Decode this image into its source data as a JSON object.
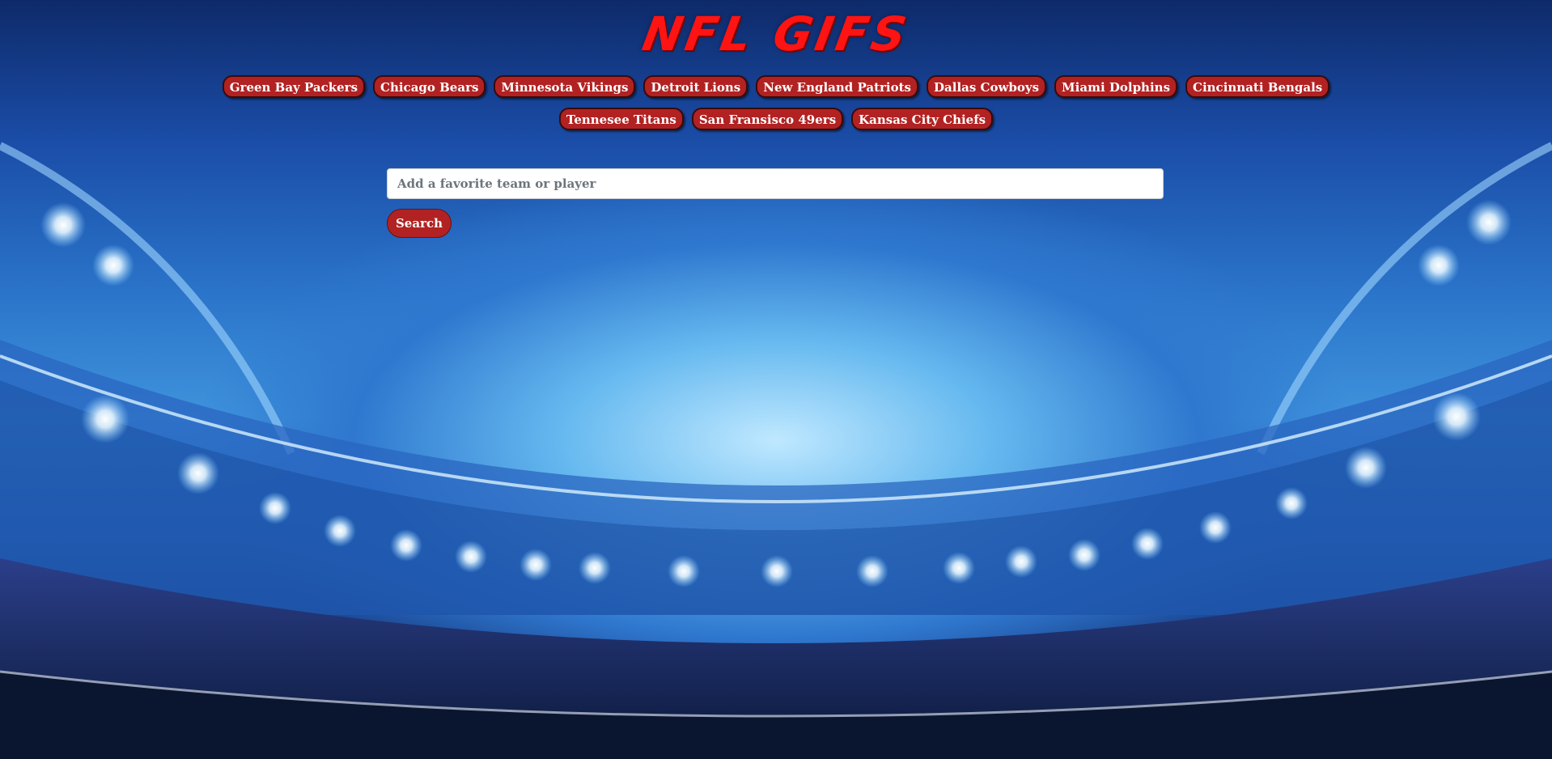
{
  "header": {
    "title": "NFL GIFS"
  },
  "teams": [
    "Green Bay Packers",
    "Chicago Bears",
    "Minnesota Vikings",
    "Detroit Lions",
    "New England Patriots",
    "Dallas Cowboys",
    "Miami Dolphins",
    "Cincinnati Bengals",
    "Tennesee Titans",
    "San Fransisco 49ers",
    "Kansas City Chiefs"
  ],
  "search": {
    "placeholder": "Add a favorite team or player",
    "value": "",
    "button_label": "Search"
  },
  "colors": {
    "accent": "#b22222",
    "logo": "#ff1414"
  }
}
